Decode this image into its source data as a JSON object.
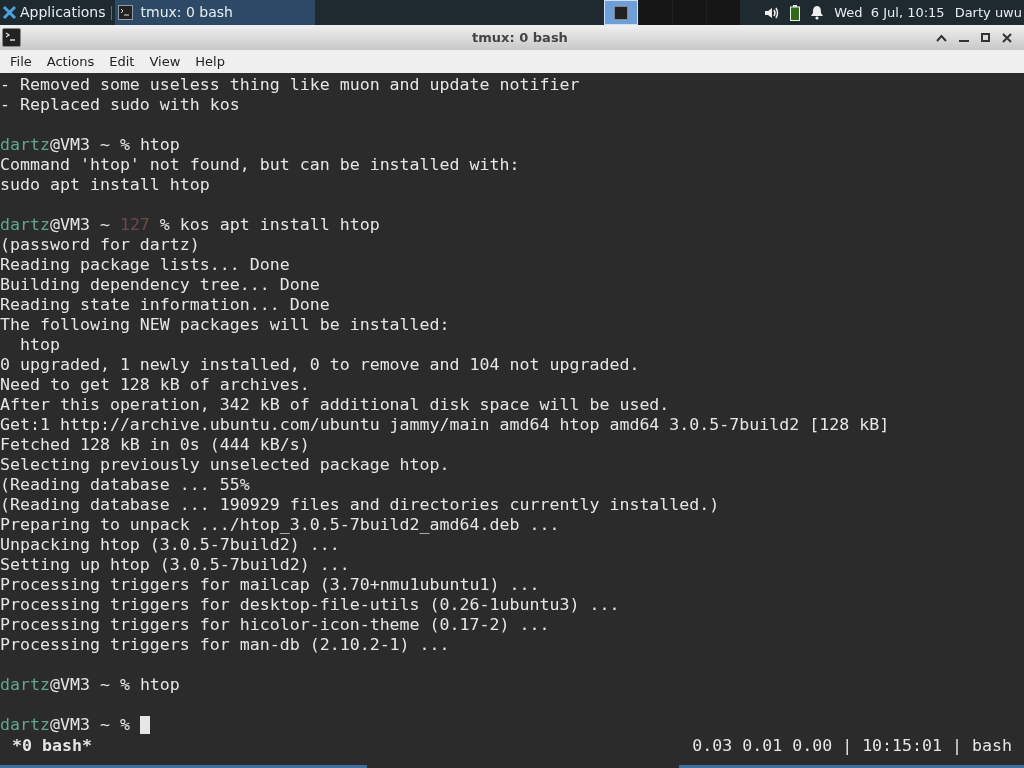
{
  "panel": {
    "applications": "Applications",
    "tasks": [
      {
        "title": "tmux: 0 bash",
        "selected": true
      }
    ],
    "workspaces": [
      {
        "selected": true
      },
      {
        "selected": false
      },
      {
        "selected": false
      },
      {
        "selected": false
      }
    ],
    "clock": "Wed  6 Jul, 10:15",
    "user": "Darty uwu"
  },
  "window": {
    "title": "tmux: 0 bash"
  },
  "menu": [
    "File",
    "Actions",
    "Edit",
    "View",
    "Help"
  ],
  "terminal": {
    "lines": [
      {
        "kind": "output",
        "text": "- Removed some useless thing like muon and update notifier"
      },
      {
        "kind": "output",
        "text": "- Replaced sudo with kos"
      },
      {
        "kind": "blank"
      },
      {
        "kind": "prompt",
        "user": "dartz",
        "host": "@VM3 ~ ",
        "symbol": "% ",
        "command": "htop"
      },
      {
        "kind": "output",
        "text": "Command 'htop' not found, but can be installed with:"
      },
      {
        "kind": "output",
        "text": "sudo apt install htop"
      },
      {
        "kind": "blank"
      },
      {
        "kind": "prompt",
        "user": "dartz",
        "host": "@VM3 ~ ",
        "code": "127 ",
        "symbol": "% ",
        "command": "kos apt install htop"
      },
      {
        "kind": "output",
        "text": "(password for dartz)"
      },
      {
        "kind": "output",
        "text": "Reading package lists... Done"
      },
      {
        "kind": "output",
        "text": "Building dependency tree... Done"
      },
      {
        "kind": "output",
        "text": "Reading state information... Done"
      },
      {
        "kind": "output",
        "text": "The following NEW packages will be installed:"
      },
      {
        "kind": "output",
        "text": "  htop"
      },
      {
        "kind": "output",
        "text": "0 upgraded, 1 newly installed, 0 to remove and 104 not upgraded."
      },
      {
        "kind": "output",
        "text": "Need to get 128 kB of archives."
      },
      {
        "kind": "output",
        "text": "After this operation, 342 kB of additional disk space will be used."
      },
      {
        "kind": "output",
        "text": "Get:1 http://archive.ubuntu.com/ubuntu jammy/main amd64 htop amd64 3.0.5-7build2 [128 kB]"
      },
      {
        "kind": "output",
        "text": "Fetched 128 kB in 0s (444 kB/s)"
      },
      {
        "kind": "output",
        "text": "Selecting previously unselected package htop."
      },
      {
        "kind": "output",
        "text": "(Reading database ... 55%"
      },
      {
        "kind": "output",
        "text": "(Reading database ... 190929 files and directories currently installed.)"
      },
      {
        "kind": "output",
        "text": "Preparing to unpack .../htop_3.0.5-7build2_amd64.deb ..."
      },
      {
        "kind": "output",
        "text": "Unpacking htop (3.0.5-7build2) ..."
      },
      {
        "kind": "output",
        "text": "Setting up htop (3.0.5-7build2) ..."
      },
      {
        "kind": "output",
        "text": "Processing triggers for mailcap (3.70+nmu1ubuntu1) ..."
      },
      {
        "kind": "output",
        "text": "Processing triggers for desktop-file-utils (0.26-1ubuntu3) ..."
      },
      {
        "kind": "output",
        "text": "Processing triggers for hicolor-icon-theme (0.17-2) ..."
      },
      {
        "kind": "output",
        "text": "Processing triggers for man-db (2.10.2-1) ..."
      },
      {
        "kind": "blank"
      },
      {
        "kind": "prompt",
        "user": "dartz",
        "host": "@VM3 ~ ",
        "symbol": "% ",
        "command": "htop"
      },
      {
        "kind": "blank"
      },
      {
        "kind": "prompt",
        "user": "dartz",
        "host": "@VM3 ~ ",
        "symbol": "% ",
        "cursor": true
      }
    ]
  },
  "status_bar": {
    "window_list": "*0 bash*",
    "right": "0.03 0.01 0.00 | 10:15:01 | bash"
  }
}
